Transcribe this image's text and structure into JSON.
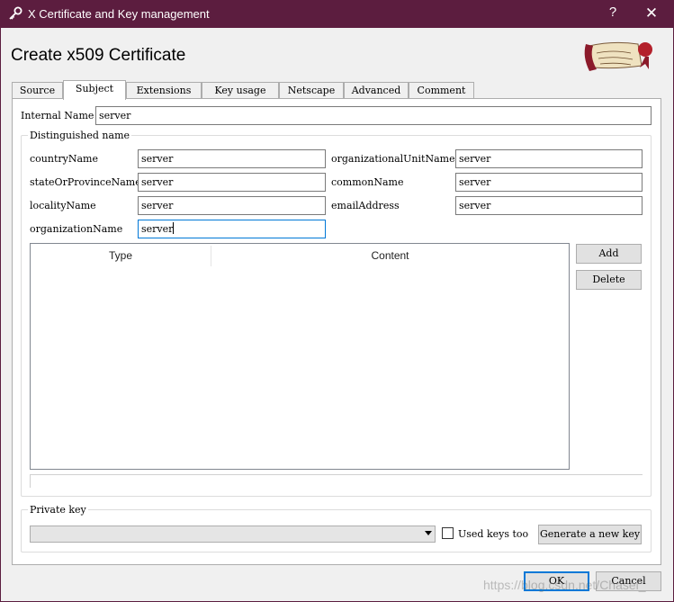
{
  "window": {
    "title": "X Certificate and Key management",
    "help_glyph": "?",
    "close_glyph": "✕"
  },
  "heading": "Create x509 Certificate",
  "tabs": [
    {
      "label": "Source",
      "active": false
    },
    {
      "label": "Subject",
      "active": true
    },
    {
      "label": "Extensions",
      "active": false
    },
    {
      "label": "Key usage",
      "active": false
    },
    {
      "label": "Netscape",
      "active": false
    },
    {
      "label": "Advanced",
      "active": false
    },
    {
      "label": "Comment",
      "active": false
    }
  ],
  "internal_name": {
    "label": "Internal Name",
    "value": "server"
  },
  "distinguished_name": {
    "title": "Distinguished name",
    "fields": [
      {
        "label": "countryName",
        "value": "server"
      },
      {
        "label": "stateOrProvinceName",
        "value": "server"
      },
      {
        "label": "localityName",
        "value": "server"
      },
      {
        "label": "organizationName",
        "value": "server"
      },
      {
        "label": "organizationalUnitName",
        "value": "server"
      },
      {
        "label": "commonName",
        "value": "server"
      },
      {
        "label": "emailAddress",
        "value": "server"
      }
    ],
    "table": {
      "columns": [
        "Type",
        "Content"
      ],
      "rows": []
    },
    "add_label": "Add",
    "delete_label": "Delete"
  },
  "private_key": {
    "title": "Private key",
    "selected": "",
    "used_keys_label": "Used keys too",
    "used_keys_checked": false,
    "generate_label": "Generate a new key"
  },
  "footer": {
    "ok_label": "OK",
    "cancel_label": "Cancel"
  },
  "watermark": "https://blog.csdn.net/Chasel_",
  "colors": {
    "titlebar": "#5c1d3f",
    "focus": "#0078d7"
  }
}
